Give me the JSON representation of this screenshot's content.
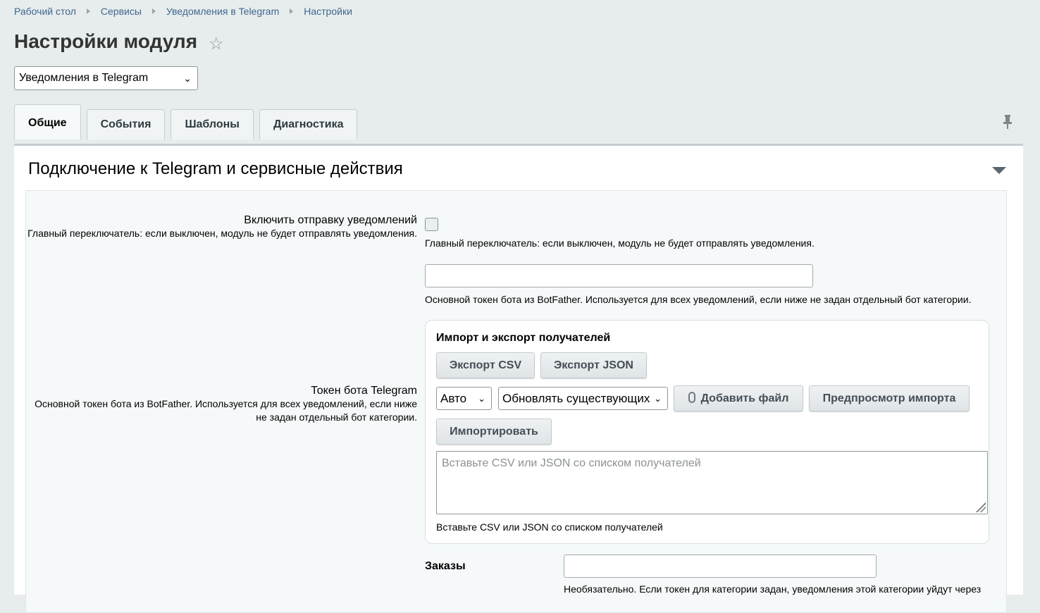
{
  "breadcrumb": [
    "Рабочий стол",
    "Сервисы",
    "Уведомления в Telegram",
    "Настройки"
  ],
  "page": {
    "title": "Настройки модуля"
  },
  "module_select": {
    "value": "Уведомления в Telegram"
  },
  "tabs": [
    {
      "label": "Общие",
      "active": true
    },
    {
      "label": "События",
      "active": false
    },
    {
      "label": "Шаблоны",
      "active": false
    },
    {
      "label": "Диагностика",
      "active": false
    }
  ],
  "section": {
    "title": "Подключение к Telegram и сервисные действия"
  },
  "fields": {
    "enable": {
      "label": "Включить отправку уведомлений",
      "hint_left": "Главный переключатель: если выключен, модуль не будет отправлять уведомления.",
      "hint_right": "Главный переключатель: если выключен, модуль не будет отправлять уведомления.",
      "checked": false
    },
    "token": {
      "label": "Токен бота Telegram",
      "hint_left": "Основной токен бота из BotFather. Используется для всех уведомлений, если ниже не задан отдельный бот категории.",
      "hint_right": "Основной токен бота из BotFather. Используется для всех уведомлений, если ниже не задан отдельный бот категории.",
      "value": ""
    }
  },
  "import": {
    "title": "Импорт и экспорт получателей",
    "export_csv": "Экспорт CSV",
    "export_json": "Экспорт JSON",
    "format_select": "Авто",
    "mode_select": "Обновлять существующих",
    "add_file": "Добавить файл",
    "preview": "Предпросмотр импорта",
    "import_btn": "Импортировать",
    "textarea_placeholder": "Вставьте CSV или JSON со списком получателей",
    "textarea_hint": "Вставьте CSV или JSON со списком получателей"
  },
  "orders": {
    "label": "Заказы",
    "value": "",
    "hint": "Необязательно. Если токен для категории задан, уведомления этой категории уйдут через"
  }
}
